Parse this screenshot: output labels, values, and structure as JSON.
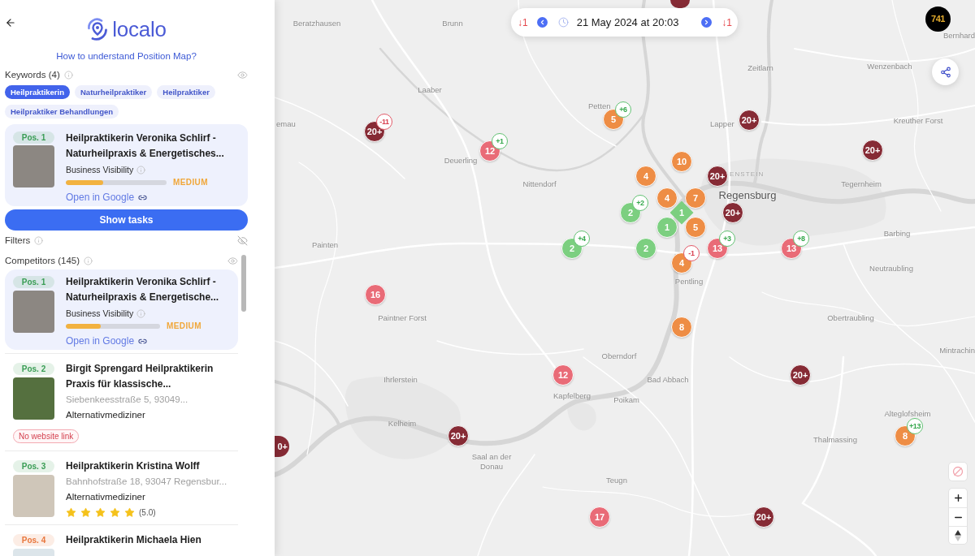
{
  "header": {
    "title": "localo",
    "help_link": "How to understand Position Map?"
  },
  "keywords": {
    "label": "Keywords (4)",
    "visible": true,
    "items": [
      {
        "text": "Heilpraktikerin",
        "selected": true
      },
      {
        "text": "Naturheilpraktiker",
        "selected": false
      },
      {
        "text": "Heilpraktiker",
        "selected": false
      },
      {
        "text": "Heilpraktiker Behandlungen",
        "selected": false
      }
    ]
  },
  "business": {
    "position": {
      "text": "Pos. 1",
      "color": "#3a9d55"
    },
    "name": "Heilpraktikerin Veronika Schlirf - Naturheilpraxis & Energetisches...",
    "visibility_label": "Business Visibility",
    "level": 0.37,
    "rating": "MEDIUM",
    "link": "Open in Google"
  },
  "show_tasks": "Show tasks",
  "filters": {
    "label": "Filters",
    "visible": false
  },
  "competitors": {
    "label": "Competitors (145)",
    "visible": true,
    "items": [
      {
        "selected": true,
        "position": {
          "text": "Pos. 1",
          "color": "#3a9d55"
        },
        "name": "Heilpraktikerin Veronika Schlirf - Naturheilpraxis & Energetische...",
        "visibility_label": "Business Visibility",
        "level": 0.37,
        "rating": "MEDIUM",
        "link": "Open in Google"
      },
      {
        "selected": false,
        "position": {
          "text": "Pos. 2",
          "color": "#3a9d55"
        },
        "name": "Birgit Sprengard Heilpraktikerin Praxis für klassische...",
        "address": "Siebenkeesstraße 5, 93049...",
        "category": "Alternativmediziner",
        "warning": "No website link"
      },
      {
        "selected": false,
        "position": {
          "text": "Pos. 3",
          "color": "#3a9d55"
        },
        "name": "Heilpraktikerin Kristina Wolff",
        "address": "Bahnhofstraße 18, 93047 Regensbur...",
        "category": "Alternativmediziner",
        "stars": 5,
        "rating_text": "(5.0)"
      },
      {
        "selected": false,
        "position": {
          "text": "Pos. 4",
          "color": "#e8773d"
        },
        "name": "Heilpraktikerin Michaela Hien"
      }
    ]
  },
  "date_bar": {
    "previous_change": "↓1",
    "date": "21 May 2024 at 20:03",
    "next_change": "↓1"
  },
  "account": {
    "avatar_text": "741"
  },
  "map": {
    "places": [
      {
        "name": "Beratzhausen",
        "kind": "town"
      },
      {
        "name": "Brunn",
        "kind": "town"
      },
      {
        "name": "Bernhard",
        "kind": "town"
      },
      {
        "name": "Zeitlarn",
        "kind": "town"
      },
      {
        "name": "Wenzenbach",
        "kind": "town"
      },
      {
        "name": "Laaber",
        "kind": "town"
      },
      {
        "name": "emau",
        "kind": "town"
      },
      {
        "name": "Petten",
        "kind": "town"
      },
      {
        "name": "Lapper",
        "kind": "town"
      },
      {
        "name": "Kreuther Forst",
        "kind": "town"
      },
      {
        "name": "Deuerling",
        "kind": "town"
      },
      {
        "name": "Nittendorf",
        "kind": "town"
      },
      {
        "name": "ENSTEIN",
        "kind": "district"
      },
      {
        "name": "Regensburg",
        "kind": "city"
      },
      {
        "name": "Tegernheim",
        "kind": "town"
      },
      {
        "name": "Painten",
        "kind": "town"
      },
      {
        "name": "Barbing",
        "kind": "town"
      },
      {
        "name": "Neutraubling",
        "kind": "town"
      },
      {
        "name": "Pentling",
        "kind": "town"
      },
      {
        "name": "Paintner Forst",
        "kind": "town"
      },
      {
        "name": "Obertraubling",
        "kind": "town"
      },
      {
        "name": "Mintrachin",
        "kind": "town"
      },
      {
        "name": "Oberndorf",
        "kind": "town"
      },
      {
        "name": "Ihrlerstein",
        "kind": "town"
      },
      {
        "name": "Bad Abbach",
        "kind": "town"
      },
      {
        "name": "Kapfelberg",
        "kind": "town"
      },
      {
        "name": "Poikam",
        "kind": "town"
      },
      {
        "name": "Kelheim",
        "kind": "town"
      },
      {
        "name": "Saal an der Donau",
        "kind": "town"
      },
      {
        "name": "Teugn",
        "kind": "town"
      },
      {
        "name": "Thalmassing",
        "kind": "town"
      },
      {
        "name": "Alteglofsheim",
        "kind": "town"
      }
    ],
    "markers": [
      {
        "kind": "clipped",
        "color": "#862b35"
      },
      {
        "kind": "pin",
        "label": "20+",
        "color": "#862b35",
        "delta": {
          "text": "-11",
          "kind": "loss"
        }
      },
      {
        "kind": "pin",
        "label": "12",
        "color": "#e96b77",
        "delta": {
          "text": "+1",
          "kind": "gain"
        }
      },
      {
        "kind": "pin",
        "label": "5",
        "color": "#ee8d45",
        "delta": {
          "text": "+6",
          "kind": "gain"
        }
      },
      {
        "kind": "pin",
        "label": "20+",
        "color": "#862b35"
      },
      {
        "kind": "pin",
        "label": "20+",
        "color": "#862b35"
      },
      {
        "kind": "pin",
        "label": "10",
        "color": "#ee8d45"
      },
      {
        "kind": "pin",
        "label": "4",
        "color": "#ee8d45"
      },
      {
        "kind": "pin",
        "label": "20+",
        "color": "#862b35"
      },
      {
        "kind": "pin",
        "label": "4",
        "color": "#ee8d45"
      },
      {
        "kind": "pin",
        "label": "7",
        "color": "#ee8d45"
      },
      {
        "kind": "pin",
        "label": "2",
        "color": "#7ccf80",
        "delta": {
          "text": "+2",
          "kind": "gain"
        }
      },
      {
        "kind": "own",
        "label": "1",
        "color": "#7ccf80"
      },
      {
        "kind": "pin",
        "label": "20+",
        "color": "#862b35"
      },
      {
        "kind": "pin",
        "label": "1",
        "color": "#7ccf80"
      },
      {
        "kind": "pin",
        "label": "5",
        "color": "#ee8d45"
      },
      {
        "kind": "pin",
        "label": "2",
        "color": "#7ccf80",
        "delta": {
          "text": "+4",
          "kind": "gain"
        }
      },
      {
        "kind": "pin",
        "label": "2",
        "color": "#7ccf80"
      },
      {
        "kind": "pin",
        "label": "13",
        "color": "#e96b77",
        "delta": {
          "text": "+3",
          "kind": "gain"
        }
      },
      {
        "kind": "pin",
        "label": "13",
        "color": "#e96b77",
        "delta": {
          "text": "+8",
          "kind": "gain"
        }
      },
      {
        "kind": "pin",
        "label": "4",
        "color": "#ee8d45",
        "delta": {
          "text": "-1",
          "kind": "loss"
        }
      },
      {
        "kind": "pin",
        "label": "16",
        "color": "#e96b77"
      },
      {
        "kind": "pin",
        "label": "8",
        "color": "#ee8d45"
      },
      {
        "kind": "pin",
        "label": "12",
        "color": "#e96b77"
      },
      {
        "kind": "pin",
        "label": "20+",
        "color": "#862b35"
      },
      {
        "kind": "pin",
        "label": "20+",
        "color": "#862b35"
      },
      {
        "kind": "pin",
        "label": "8",
        "color": "#ee8d45",
        "delta": {
          "text": "+13",
          "kind": "gain"
        }
      },
      {
        "kind": "pin",
        "label": "17",
        "color": "#e96b77"
      },
      {
        "kind": "pin",
        "label": "20+",
        "color": "#862b35"
      },
      {
        "kind": "clipped",
        "label": "0+",
        "color": "#862b35"
      }
    ]
  }
}
